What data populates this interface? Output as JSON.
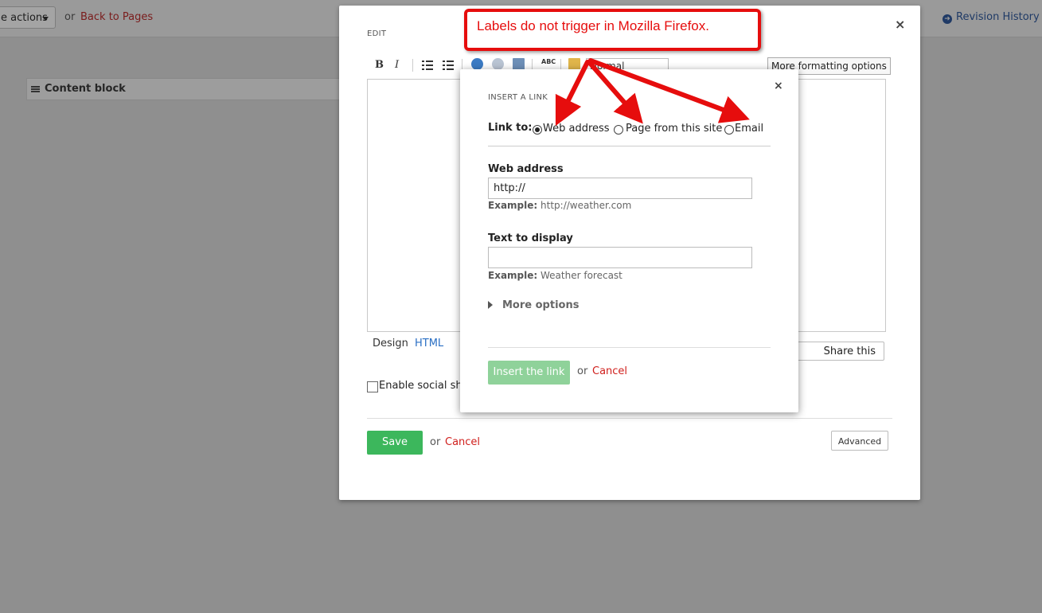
{
  "background": {
    "actions_label": "e actions",
    "or_text": "or",
    "back_link": "Back to Pages",
    "revision_history": "Revision History",
    "content_block": "Content block"
  },
  "editor_modal": {
    "title": "EDIT",
    "close": "×",
    "toolbar": {
      "bold": "B",
      "italic": "I",
      "format_select": "Normal",
      "more_formatting": "More formatting options"
    },
    "tabs": {
      "design": "Design",
      "html": "HTML"
    },
    "share_button": "Share this content",
    "social_checkbox_label": "Enable social sharing",
    "social_checked": false,
    "save": "Save",
    "or_text": "or",
    "cancel": "Cancel",
    "advanced": "Advanced"
  },
  "insert_link_dialog": {
    "title": "INSERT A LINK",
    "close": "×",
    "link_to_label": "Link to:",
    "options": [
      {
        "label": "Web address",
        "selected": true
      },
      {
        "label": "Page from this site",
        "selected": false
      },
      {
        "label": "Email",
        "selected": false
      }
    ],
    "web_address": {
      "label": "Web address",
      "value": "http://",
      "example_prefix": "Example:",
      "example_text": "http://weather.com"
    },
    "text_to_display": {
      "label": "Text to display",
      "value": "",
      "example_prefix": "Example:",
      "example_text": "Weather forecast"
    },
    "more_options": "More options",
    "insert_button": "Insert the link",
    "or_text": "or",
    "cancel": "Cancel"
  },
  "annotation": {
    "text": "Labels do not trigger in Mozilla Firefox.",
    "color": "#e60d0d"
  }
}
